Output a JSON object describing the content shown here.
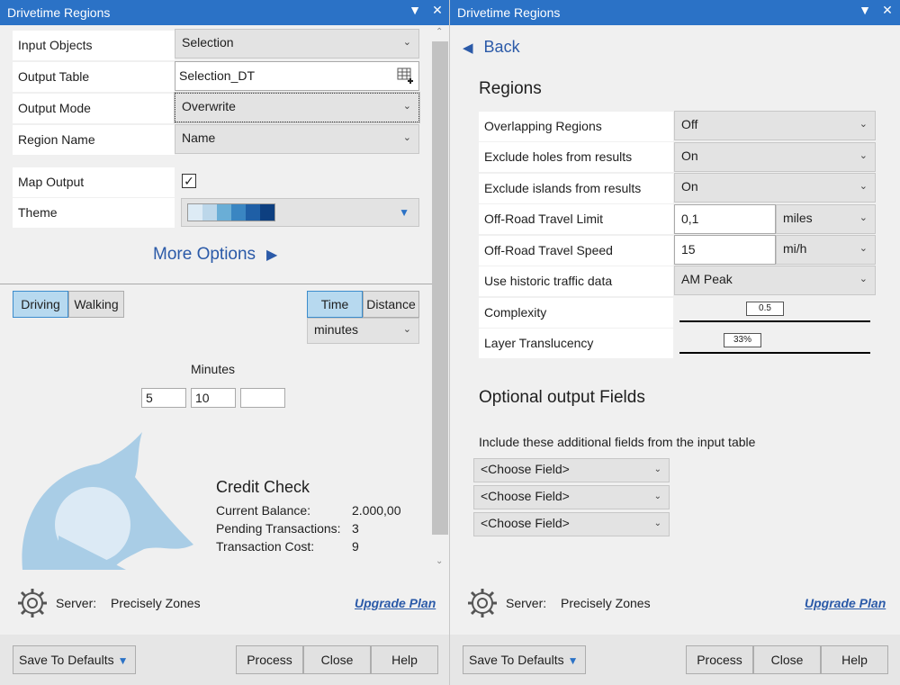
{
  "left": {
    "title": "Drivetime Regions",
    "rows": [
      {
        "label": "Input Objects",
        "value": "Selection"
      },
      {
        "label": "Output Table",
        "value": "Selection_DT"
      },
      {
        "label": "Output Mode",
        "value": "Overwrite"
      },
      {
        "label": "Region Name",
        "value": "Name"
      }
    ],
    "map_output_label": "Map Output",
    "theme_label": "Theme",
    "theme_colors": [
      "#ddebf5",
      "#bcd7ea",
      "#6aaed6",
      "#3a86c2",
      "#1f5fa6",
      "#0d3f80"
    ],
    "more_options": "More Options",
    "driving": "Driving",
    "walking": "Walking",
    "time": "Time",
    "distance": "Distance",
    "units": "minutes",
    "minutes_label": "Minutes",
    "minutes_values": [
      "5",
      "10",
      ""
    ],
    "credit": {
      "title": "Credit Check",
      "current_balance_label": "Current Balance:",
      "current_balance": "2.000,00",
      "pending_label": "Pending Transactions:",
      "pending": "3",
      "cost_label": "Transaction Cost:",
      "cost": "9"
    }
  },
  "right": {
    "title": "Drivetime Regions",
    "back": "Back",
    "regions_header": "Regions",
    "rows": [
      {
        "label": "Overlapping Regions",
        "value": "Off"
      },
      {
        "label": "Exclude holes from results",
        "value": "On"
      },
      {
        "label": "Exclude islands from results",
        "value": "On"
      },
      {
        "label": "Off-Road Travel Limit",
        "value": "0,1",
        "unit": "miles"
      },
      {
        "label": "Off-Road Travel Speed",
        "value": "15",
        "unit": "mi/h"
      },
      {
        "label": "Use historic traffic data",
        "value": "AM Peak"
      }
    ],
    "complexity_label": "Complexity",
    "complexity_value": "0.5",
    "translucency_label": "Layer Translucency",
    "translucency_value": "33%",
    "optional_header": "Optional output Fields",
    "include_label": "Include these additional fields from the input table",
    "choose_fields": [
      "<Choose Field>",
      "<Choose Field>",
      "<Choose Field>"
    ]
  },
  "footer": {
    "server_label": "Server:",
    "server_name": "Precisely Zones",
    "upgrade": "Upgrade Plan",
    "save_defaults": "Save To Defaults",
    "process": "Process",
    "close": "Close",
    "help": "Help"
  },
  "colors": {
    "titlebar": "#2b72c6",
    "link": "#2b5aa8",
    "active": "#b7d9ef"
  }
}
